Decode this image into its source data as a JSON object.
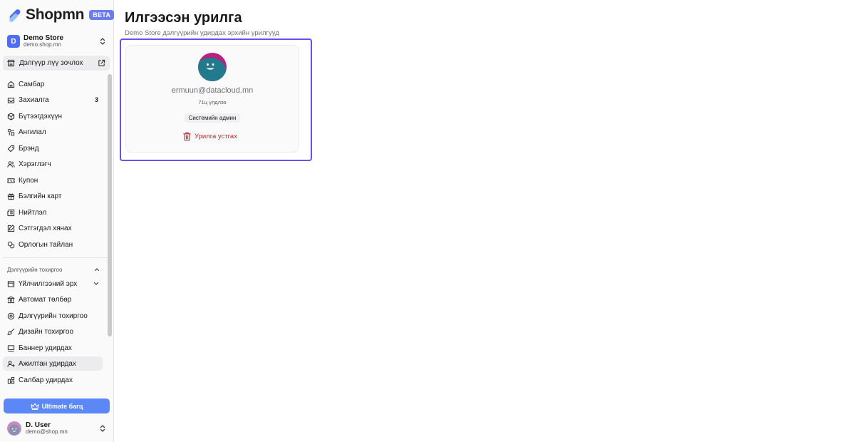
{
  "brand": {
    "name": "Shopmn",
    "badge": "BETA"
  },
  "store": {
    "initial": "D",
    "name": "Demo Store",
    "domain": "demo.shop.mn"
  },
  "visit_store": {
    "label": "Дэлгүүр лүү зочлох"
  },
  "nav": {
    "items": [
      {
        "label": "Самбар",
        "icon": "home-icon"
      },
      {
        "label": "Захиалга",
        "icon": "orders-icon",
        "count": "3"
      },
      {
        "label": "Бүтээгдэхүүн",
        "icon": "package-icon"
      },
      {
        "label": "Ангилал",
        "icon": "shapes-icon"
      },
      {
        "label": "Брэнд",
        "icon": "tag-icon"
      },
      {
        "label": "Хэрэглэгч",
        "icon": "users-icon"
      },
      {
        "label": "Купон",
        "icon": "ticket-icon"
      },
      {
        "label": "Бэлгийн карт",
        "icon": "gift-icon"
      },
      {
        "label": "Нийтлэл",
        "icon": "newspaper-icon"
      },
      {
        "label": "Сэтгэгдэл хянах",
        "icon": "comment-review-icon"
      },
      {
        "label": "Орлогын тайлан",
        "icon": "coins-icon"
      }
    ],
    "settings_section": "Дэлгүүрийн тохиргоо",
    "settings_items": [
      {
        "label": "Үйлчилгээний эрх",
        "icon": "subscription-icon"
      },
      {
        "label": "Автомат төлбөр",
        "icon": "bank-icon"
      },
      {
        "label": "Дэлгүүрийн тохиргоо",
        "icon": "settings-icon"
      },
      {
        "label": "Дизайн тохиргоо",
        "icon": "paintbrush-icon"
      },
      {
        "label": "Баннер удирдах",
        "icon": "banner-icon"
      },
      {
        "label": "Ажилтан удирдах",
        "icon": "user-plus-icon"
      },
      {
        "label": "Салбар удирдах",
        "icon": "branch-icon"
      }
    ]
  },
  "upgrade": {
    "label": "Ultimate багц"
  },
  "user": {
    "name": "D. User",
    "email": "demo@shop.mn"
  },
  "page": {
    "title": "Илгээсэн урилга",
    "subtitle": "Demo Store дэлгүүрийн удирдах эрхийн урилгууд"
  },
  "invitation": {
    "email": "ermuun@datacloud.mn",
    "time": "71ц үлдлээ",
    "role": "Системийн админ",
    "revoke_label": "Урилга устгах"
  },
  "colors": {
    "accent": "#5b87f7",
    "highlight": "#6d4df0",
    "danger": "#c2262d",
    "avatar_face": "#237a8c",
    "avatar_bg": "#b5227f"
  }
}
